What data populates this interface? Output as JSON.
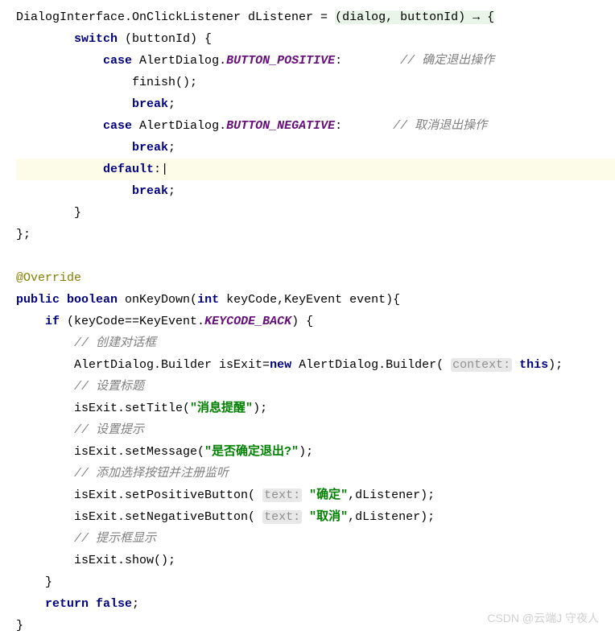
{
  "code": {
    "l1_p1": "DialogInterface.OnClickListener dListener = ",
    "l1_lambda": "(dialog, buttonId) → {",
    "l2_switch": "switch",
    "l2_rest": " (buttonId) {",
    "l3_case": "case",
    "l3_class": " AlertDialog.",
    "l3_const": "BUTTON_POSITIVE",
    "l3_colon": ":",
    "l3_comment": "// 确定退出操作",
    "l4": "finish();",
    "l5_break": "break",
    "l5_semi": ";",
    "l6_case": "case",
    "l6_class": " AlertDialog.",
    "l6_const": "BUTTON_NEGATIVE",
    "l6_colon": ":",
    "l6_comment": "// 取消退出操作",
    "l7_break": "break",
    "l7_semi": ";",
    "l8_default": "default",
    "l8_colon": ":",
    "l9_break": "break",
    "l9_semi": ";",
    "l10": "}",
    "l11": "};",
    "blank": "",
    "l12_anno": "@Override",
    "l13_public": "public",
    "l13_boolean": " boolean",
    "l13_method": " onKeyDown",
    "l13_paren": "(",
    "l13_int": "int",
    "l13_rest": " keyCode,KeyEvent event){",
    "l14_if": "if",
    "l14_rest1": " (keyCode==KeyEvent.",
    "l14_const": "KEYCODE_BACK",
    "l14_rest2": ") {",
    "l15": "// 创建对话框",
    "l16_p1": "AlertDialog.Builder isExit=",
    "l16_new": "new",
    "l16_p2": " AlertDialog.Builder( ",
    "l16_hint": "context:",
    "l16_this": " this",
    "l16_end": ");",
    "l17": "// 设置标题",
    "l18_p1": "isExit.setTitle(",
    "l18_str": "\"消息提醒\"",
    "l18_end": ");",
    "l19": "// 设置提示",
    "l20_p1": "isExit.setMessage(",
    "l20_str": "\"是否确定退出?\"",
    "l20_end": ");",
    "l21": "// 添加选择按钮并注册监听",
    "l22_p1": "isExit.setPositiveButton( ",
    "l22_hint": "text:",
    "l22_str": " \"确定\"",
    "l22_end": ",dListener);",
    "l23_p1": "isExit.setNegativeButton( ",
    "l23_hint": "text:",
    "l23_str": " \"取消\"",
    "l23_end": ",dListener);",
    "l24": "// 提示框显示",
    "l25": "isExit.show();",
    "l26": "}",
    "l27_return": "return",
    "l27_false": " false",
    "l27_semi": ";",
    "l28": "}"
  },
  "watermark": "CSDN @云端J 守夜人"
}
